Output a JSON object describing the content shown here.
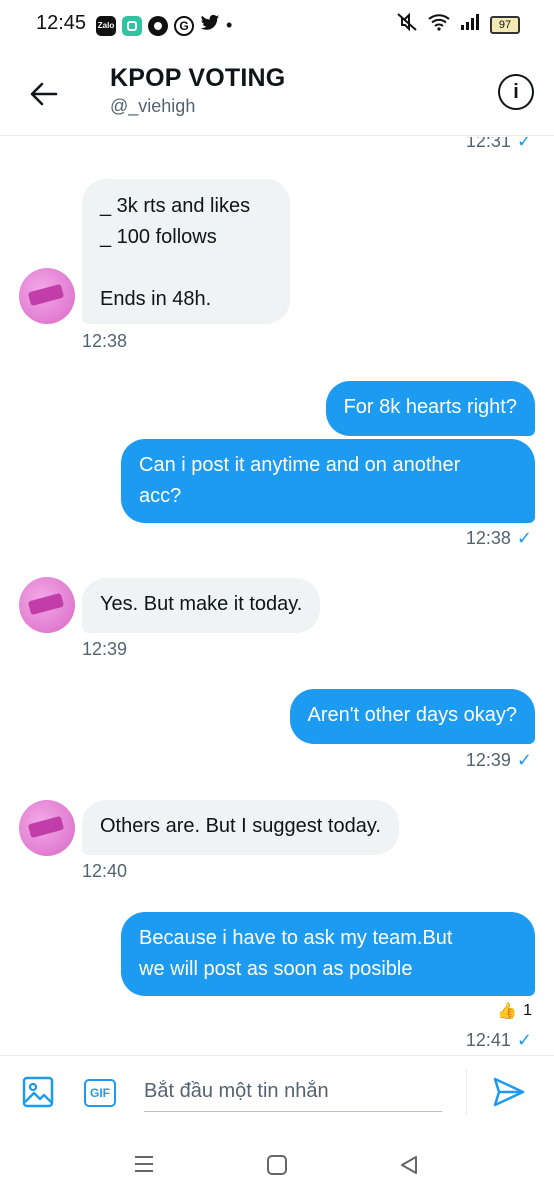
{
  "status": {
    "time": "12:45",
    "battery": "97",
    "apps": [
      "Zalo",
      "app-icon",
      "headset-icon",
      "G",
      "twitter-icon",
      "•"
    ]
  },
  "header": {
    "title": "KPOP VOTING",
    "handle": "@_viehigh"
  },
  "messages": {
    "top_time": "12:31",
    "msg1_lines": [
      "_ 3k rts and likes",
      "_ 100 follows",
      "",
      "Ends in 48h."
    ],
    "msg1_time": "12:38",
    "msg2": "For 8k hearts right?",
    "msg3_line1": "Can i post it anytime and on another",
    "msg3_line2": "acc?",
    "msg3_time": "12:38",
    "msg4": "Yes. But make it today.",
    "msg4_time": "12:39",
    "msg5": "Aren't other days okay?",
    "msg5_time": "12:39",
    "msg6": "Others are. But I suggest today.",
    "msg6_time": "12:40",
    "msg7_line1": "Because i have to ask my team.But",
    "msg7_line2": "we will post as soon as posible",
    "reaction_emoji": "👍",
    "reaction_count": "1",
    "msg7_time": "12:41",
    "check_mark": "✓"
  },
  "composer": {
    "placeholder": "Bắt đầu một tin nhắn",
    "gif_label": "GIF"
  },
  "colors": {
    "accent": "#1d9bf0",
    "bubble_in": "#eff3f4",
    "text_muted": "#536471"
  }
}
